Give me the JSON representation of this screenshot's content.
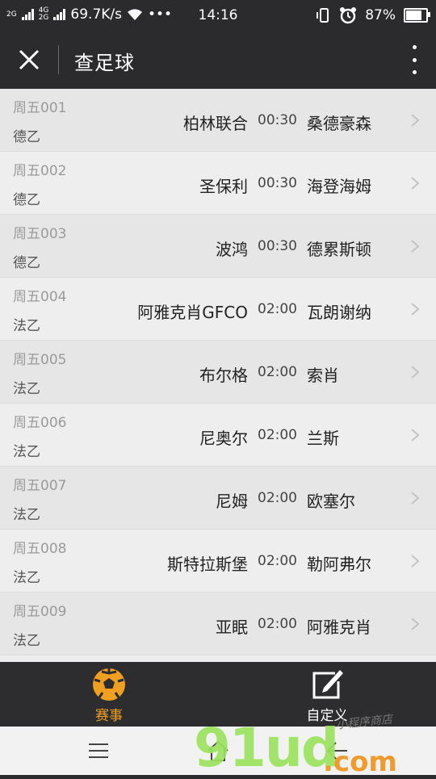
{
  "status_bar": {
    "net_top": "2G",
    "net_sub_top": "4G",
    "net_sub_bottom": "2G",
    "speed": "69.7K/s",
    "more": "•••",
    "time": "14:16",
    "battery": "87%",
    "battery_level": 0.87
  },
  "navbar": {
    "title": "查足球"
  },
  "matches": [
    {
      "week": "周五001",
      "league": "德乙",
      "home": "柏林联合",
      "time": "00:30",
      "away": "桑德豪森"
    },
    {
      "week": "周五002",
      "league": "德乙",
      "home": "圣保利",
      "time": "00:30",
      "away": "海登海姆"
    },
    {
      "week": "周五003",
      "league": "德乙",
      "home": "波鸿",
      "time": "00:30",
      "away": "德累斯顿"
    },
    {
      "week": "周五004",
      "league": "法乙",
      "home": "阿雅克肖GFCO",
      "time": "02:00",
      "away": "瓦朗谢纳"
    },
    {
      "week": "周五005",
      "league": "法乙",
      "home": "布尔格",
      "time": "02:00",
      "away": "索肖"
    },
    {
      "week": "周五006",
      "league": "法乙",
      "home": "尼奥尔",
      "time": "02:00",
      "away": "兰斯"
    },
    {
      "week": "周五007",
      "league": "法乙",
      "home": "尼姆",
      "time": "02:00",
      "away": "欧塞尔"
    },
    {
      "week": "周五008",
      "league": "法乙",
      "home": "斯特拉斯堡",
      "time": "02:00",
      "away": "勒阿弗尔"
    },
    {
      "week": "周五009",
      "league": "法乙",
      "home": "亚眠",
      "time": "02:00",
      "away": "阿雅克肖"
    }
  ],
  "tabbar": {
    "tabs": [
      {
        "label": "赛事",
        "icon": "soccer-ball-icon",
        "active": true
      },
      {
        "label": "自定义",
        "icon": "edit-icon",
        "active": false
      }
    ],
    "active_color": "#f0a020"
  },
  "watermark": {
    "main": "91ud",
    "suffix": ".com",
    "sub": "小程序商店"
  }
}
